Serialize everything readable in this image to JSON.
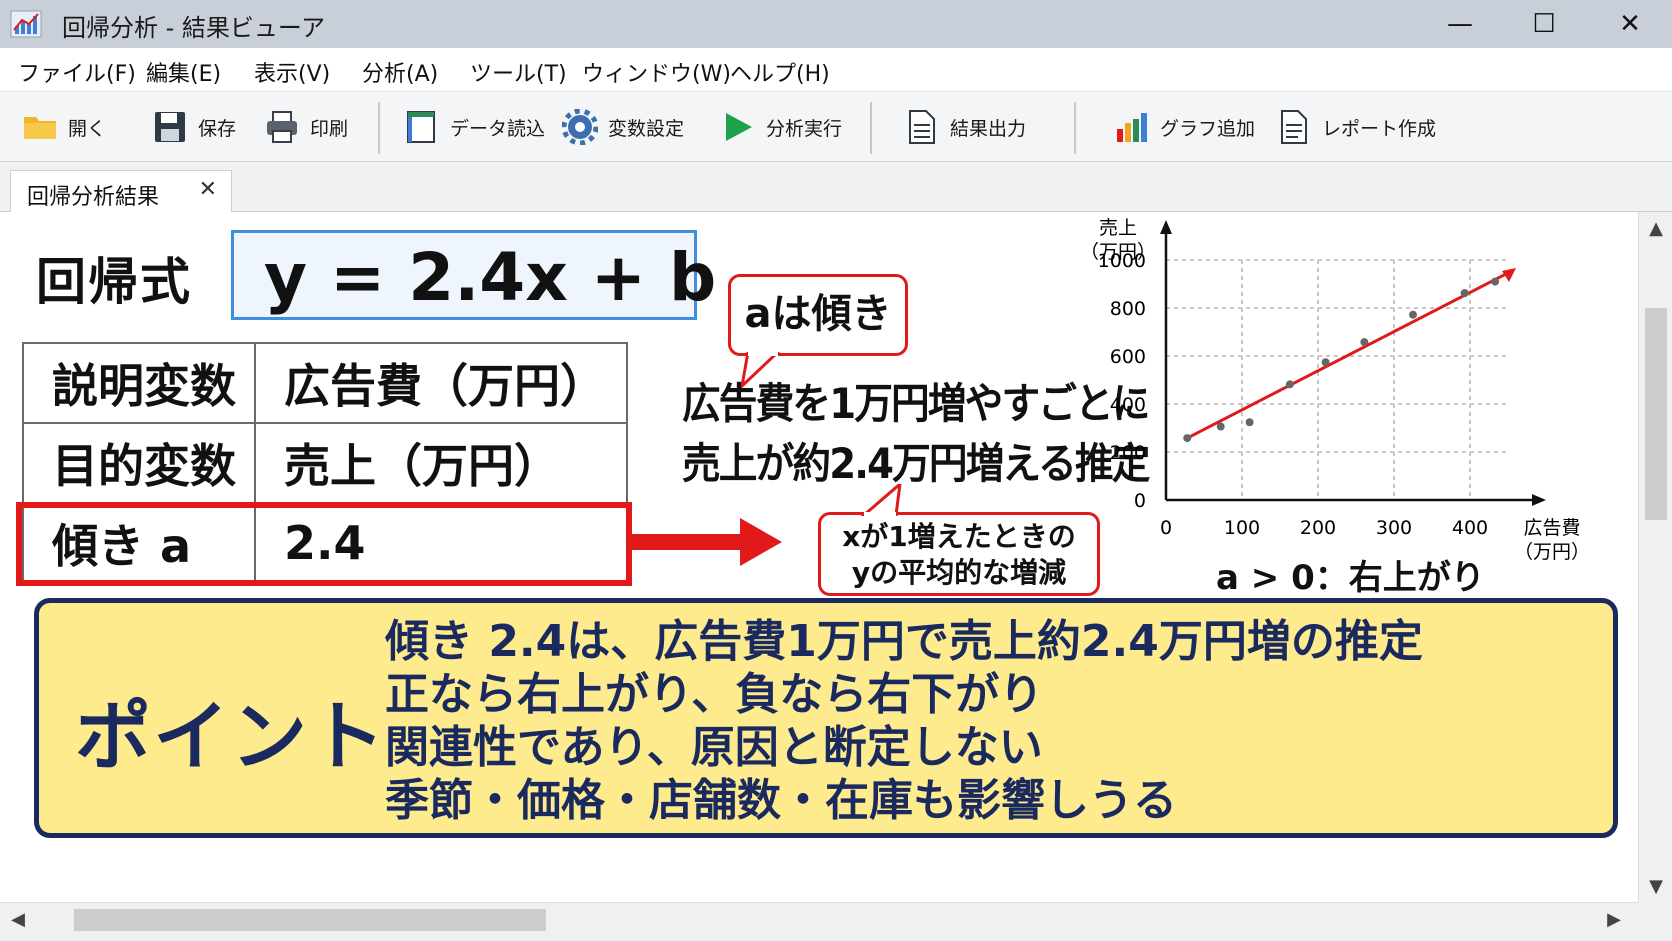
{
  "window": {
    "title": "回帰分析 - 結果ビューア",
    "minimize": "—",
    "maximize": "☐",
    "close": "✕"
  },
  "menu": [
    "ファイル(F)",
    "編集(E)",
    "表示(V)",
    "分析(A)",
    "ツール(T)",
    "ウィンドウ(W)",
    "ヘルプ(H)"
  ],
  "toolbar": {
    "open": "開く",
    "save": "保存",
    "print": "印刷",
    "import": "データ読込",
    "variables": "変数設定",
    "run": "分析実行",
    "export": "結果出力",
    "add_chart": "グラフ追加",
    "report": "レポート作成"
  },
  "tab": {
    "label": "回帰分析結果",
    "close": "✕"
  },
  "equation": {
    "label": "回帰式",
    "formula": "y = 2.4x + b"
  },
  "variables_table": [
    {
      "key": "説明変数",
      "value": "広告費（万円）"
    },
    {
      "key": "目的変数",
      "value": "売上（万円）"
    },
    {
      "key": "傾き a",
      "value": "2.4"
    }
  ],
  "callouts": {
    "a_label": "aは傾き",
    "explanation": [
      "広告費を1万円増やすごとに",
      "売上が約2.4万円増える推定"
    ],
    "x_note": [
      "xが1増えたときの",
      "yの平均的な増減"
    ]
  },
  "chart_data": {
    "type": "scatter",
    "ylabel": [
      "売上",
      "（万円）"
    ],
    "xlabel": [
      "広告費",
      "（万円）"
    ],
    "xlim": [
      0,
      450
    ],
    "ylim": [
      0,
      1000
    ],
    "x_ticks": [
      0,
      100,
      200,
      300,
      400
    ],
    "y_ticks": [
      0,
      200,
      400,
      600,
      800,
      1000
    ],
    "grid": true,
    "points": [
      {
        "x": 28,
        "y": 258
      },
      {
        "x": 72,
        "y": 306
      },
      {
        "x": 110,
        "y": 324
      },
      {
        "x": 163,
        "y": 482
      },
      {
        "x": 210,
        "y": 574
      },
      {
        "x": 261,
        "y": 658
      },
      {
        "x": 325,
        "y": 772
      },
      {
        "x": 393,
        "y": 862
      },
      {
        "x": 433,
        "y": 910
      }
    ],
    "trend_line": {
      "x": [
        28,
        450
      ],
      "y": [
        258,
        946
      ]
    },
    "note": "a > 0：右上がり"
  },
  "point": {
    "title": "ポイント",
    "lines": [
      "傾き 2.4は、広告費1万円で売上約2.4万円増の推定",
      "正なら右上がり、負なら右下がり",
      "関連性であり、原因と断定しない",
      "季節・価格・店舗数・在庫も影響しうる"
    ]
  },
  "colors": {
    "accent_red": "#e01a1a",
    "equation_border": "#3f8fdc",
    "point_bg": "#fdeb8e",
    "point_border": "#1b2a5e"
  }
}
